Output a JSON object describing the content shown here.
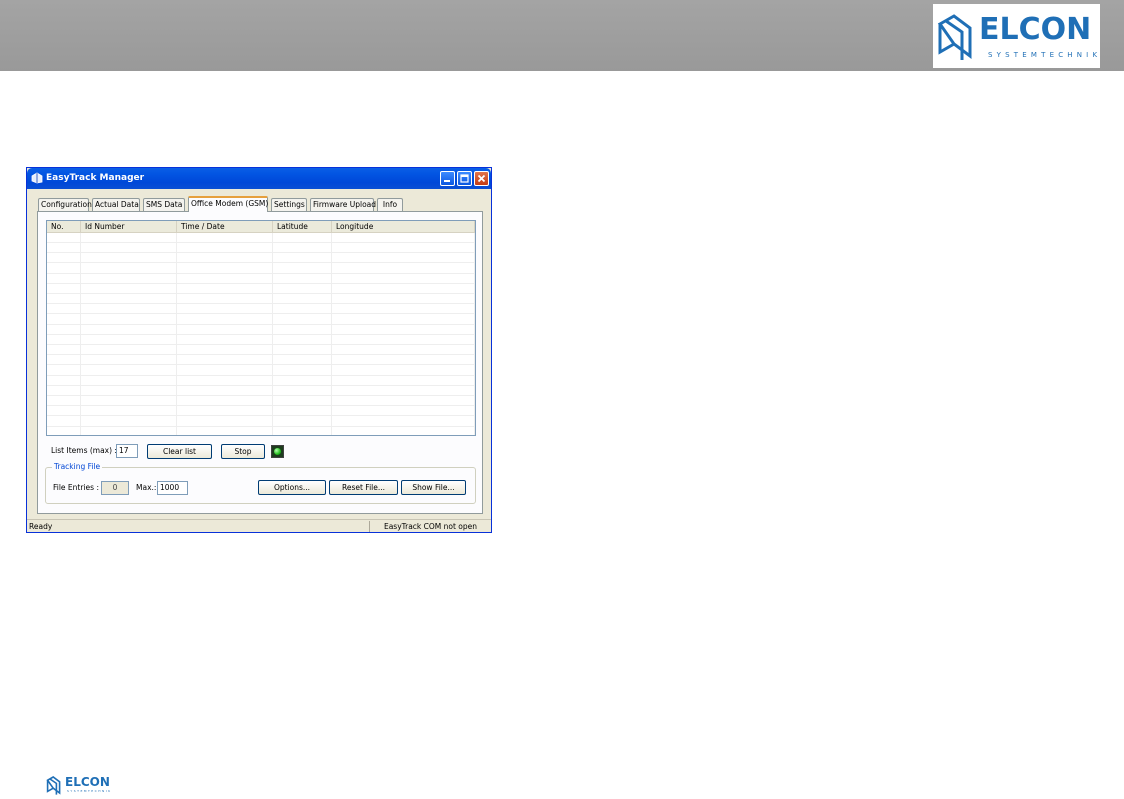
{
  "brand": {
    "name": "ELCON",
    "tagline": "SYSTEMTECHNIK",
    "color": "#1f6fb6"
  },
  "window": {
    "title": "EasyTrack Manager",
    "buttons": [
      "minimize",
      "maximize",
      "close"
    ]
  },
  "tabs": [
    {
      "label": "Configuration",
      "active": false
    },
    {
      "label": "Actual Data",
      "active": false
    },
    {
      "label": "SMS Data",
      "active": false
    },
    {
      "label": "Office Modem (GSM)",
      "active": true
    },
    {
      "label": "Settings",
      "active": false
    },
    {
      "label": "Firmware Upload",
      "active": false
    },
    {
      "label": "Info",
      "active": false
    }
  ],
  "list": {
    "columns": [
      "No.",
      "Id Number",
      "Time / Date",
      "Latitude",
      "Longitude"
    ],
    "rows": []
  },
  "controls": {
    "list_items_label": "List Items (max) :",
    "list_items_value": "17",
    "clear_list_label": "Clear list",
    "stop_label": "Stop",
    "led_state": "on",
    "led_color": "#22c01c"
  },
  "tracking": {
    "group_label": "Tracking File",
    "file_entries_label": "File Entries :",
    "file_entries_value": "0",
    "max_label": "Max.:",
    "max_value": "1000",
    "options_label": "Options...",
    "reset_file_label": "Reset File...",
    "show_file_label": "Show File..."
  },
  "status": {
    "left": "Ready",
    "right": "EasyTrack COM not open"
  }
}
